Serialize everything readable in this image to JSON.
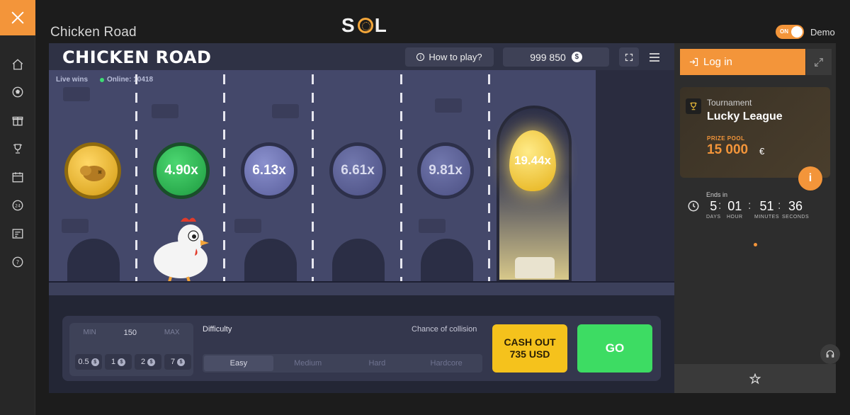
{
  "header": {
    "page_title": "Chicken Road",
    "brand_logo": "SOL",
    "demo_toggle_state": "ON",
    "demo_label": "Demo"
  },
  "sidebar": {
    "items": [
      "close-icon",
      "home-icon",
      "soccer-ball-icon",
      "gift-icon",
      "trophy-icon",
      "calendar-icon",
      "24h-icon",
      "news-icon",
      "help-icon"
    ]
  },
  "game": {
    "logo": "CHICKEN ROAD",
    "how_to_play": "How to play?",
    "balance": "999 850",
    "currency_symbol": "$",
    "live_wins": "Live wins",
    "online": "Online: 10418",
    "multipliers": [
      "4.90x",
      "6.13x",
      "6.61x",
      "9.81x",
      "19.44x"
    ]
  },
  "panel": {
    "bet_min": "MIN",
    "bet_value": "150",
    "bet_max": "MAX",
    "chips": [
      "0.5",
      "1",
      "2",
      "7"
    ],
    "difficulty_label": "Difficulty",
    "collision_label": "Chance of collision",
    "difficulty_options": [
      "Easy",
      "Medium",
      "Hard",
      "Hardcore"
    ],
    "selected_difficulty": "Easy",
    "cashout_line1": "CASH OUT",
    "cashout_line2": "735 USD",
    "go_label": "GO"
  },
  "right_panel": {
    "login_label": "Log in",
    "tournament_small": "Tournament",
    "tournament_title": "Lucky League",
    "prize_pool_label": "PRIZE POOL",
    "prize_amount": "15 000",
    "prize_currency": "€",
    "ends_in": "Ends in",
    "countdown": [
      {
        "value": "5",
        "unit": "DAYS"
      },
      {
        "value": "01",
        "unit": "HOUR"
      },
      {
        "value": "51",
        "unit": "MINUTES"
      },
      {
        "value": "36",
        "unit": "SECONDS"
      }
    ]
  },
  "colors": {
    "accent": "#f3953a",
    "go": "#3ddc63",
    "cashout": "#f5c21c"
  }
}
